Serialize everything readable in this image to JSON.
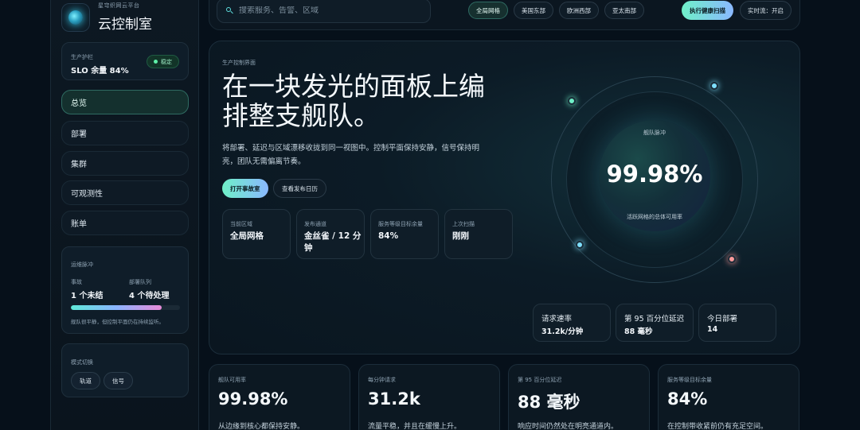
{
  "brand": {
    "subtitle": "星穹织网云平台",
    "title": "云控制室"
  },
  "slo_card": {
    "label": "生产护栏",
    "value": "SLO 余量 84%",
    "badge": "稳定"
  },
  "nav": [
    {
      "label": "总览",
      "active": true
    },
    {
      "label": "部署"
    },
    {
      "label": "集群"
    },
    {
      "label": "可观测性"
    },
    {
      "label": "账单"
    }
  ],
  "pulse_card": {
    "title": "运维脉冲",
    "col1_label": "事故",
    "col1_value": "1 个未结",
    "col2_label": "部署队列",
    "col2_value": "4 个待处理",
    "progress": 0.83,
    "note": "舰队很平静，但控制平面仍在持续监听。"
  },
  "mode_card": {
    "title": "模式切换",
    "chips": [
      "轨道",
      "信号"
    ]
  },
  "topbar": {
    "search_placeholder": "搜索服务、告警、区域",
    "regions": [
      {
        "label": "全局网格",
        "active": true
      },
      {
        "label": "美国东部"
      },
      {
        "label": "欧洲西部"
      },
      {
        "label": "亚太南部"
      }
    ],
    "health_button": "执行健康扫描",
    "live_button": "实时流：开启"
  },
  "hero": {
    "tag": "生产控制界面",
    "title": "在一块发光的面板上编排整支舰队。",
    "description": "将部署、延迟与区域漂移收拢到同一视图中。控制平面保持安静，信号保持明亮，团队无需偏离节奏。",
    "primary_button": "打开事故室",
    "secondary_button": "查看发布日历",
    "info_cards": [
      {
        "label": "当前区域",
        "value": "全局网格"
      },
      {
        "label": "发布通道",
        "value": "金丝雀 / 12 分钟"
      },
      {
        "label": "服务等级目标余量",
        "value": "84%"
      },
      {
        "label": "上次扫描",
        "value": "刚刚"
      }
    ]
  },
  "gauge": {
    "label": "舰队脉冲",
    "value": "99.98%",
    "caption": "活跃网格的总体可用率"
  },
  "hero_stats": [
    {
      "label": "请求速率",
      "value": "31.2k/分钟"
    },
    {
      "label": "第 95 百分位延迟",
      "value": "88 毫秒"
    },
    {
      "label": "今日部署",
      "value": "14"
    }
  ],
  "kpis": [
    {
      "label": "舰队可用率",
      "value": "99.98%",
      "note": "从边缘到核心都保持安静。"
    },
    {
      "label": "每分钟请求",
      "value": "31.2k",
      "note": "流量平稳，并且在缓慢上升。"
    },
    {
      "label": "第 95 百分位延迟",
      "value": "88 毫秒",
      "note": "响应时间仍然处在明亮通道内。"
    },
    {
      "label": "服务等级目标余量",
      "value": "84%",
      "note": "在控制带收紧前仍有充足空间。"
    }
  ],
  "colors": {
    "accent": "#6ff0c8",
    "accent2": "#8ab8ff",
    "background": "#06101a"
  }
}
